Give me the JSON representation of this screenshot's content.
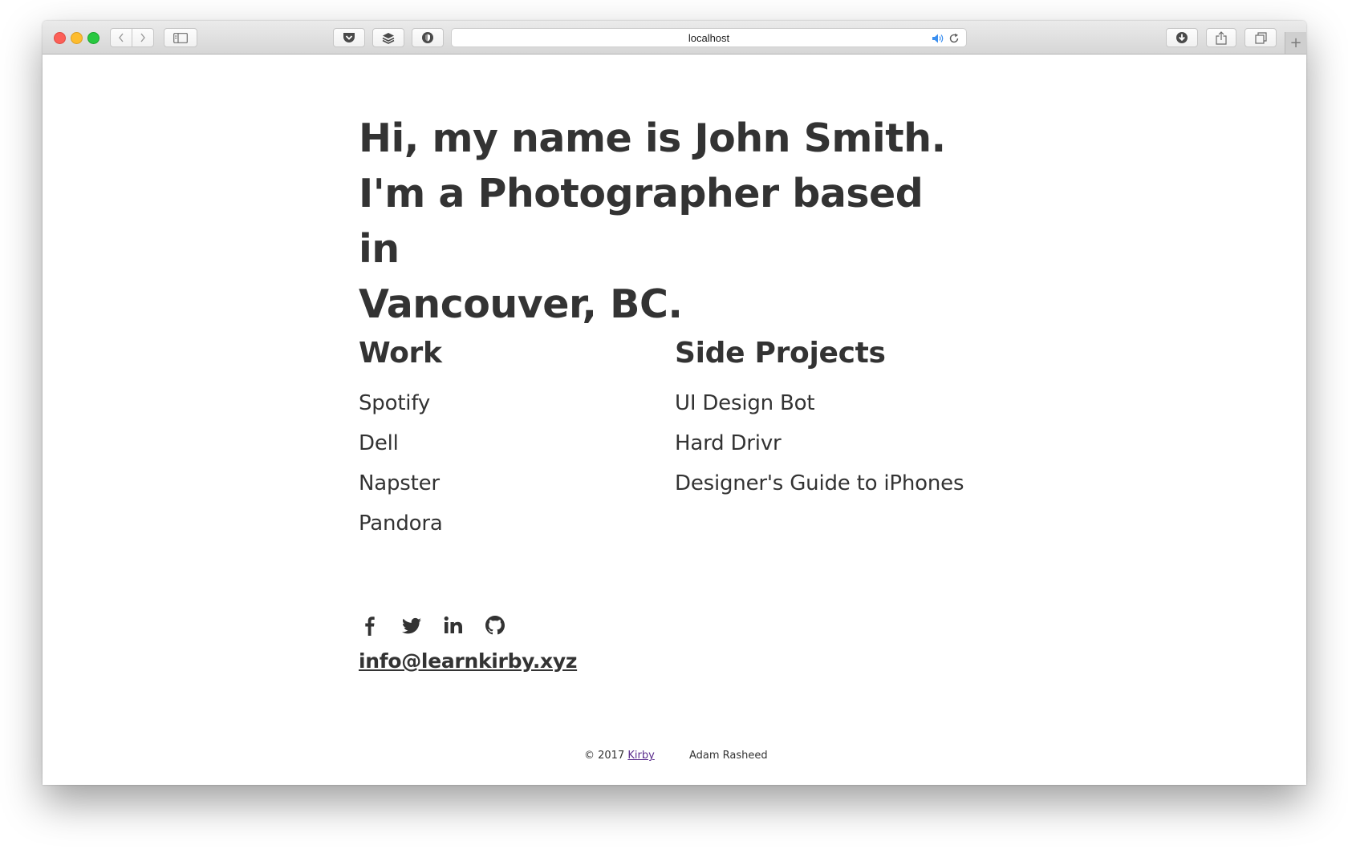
{
  "browser": {
    "url": "localhost"
  },
  "hero": {
    "line1": "Hi, my name is John Smith.",
    "line2": "I'm a Photographer based in",
    "line3": "Vancouver, BC."
  },
  "work": {
    "heading": "Work",
    "items": [
      "Spotify",
      "Dell",
      "Napster",
      "Pandora"
    ]
  },
  "side_projects": {
    "heading": "Side Projects",
    "items": [
      "UI Design Bot",
      "Hard Drivr",
      "Designer's Guide to iPhones"
    ]
  },
  "social": {
    "icons": [
      "facebook-icon",
      "twitter-icon",
      "linkedin-icon",
      "github-icon"
    ]
  },
  "contact": {
    "email": "info@learnkirby.xyz"
  },
  "footer": {
    "copyright_prefix": "© 2017",
    "copyright_link": "Kirby",
    "author": "Adam Rasheed"
  },
  "colors": {
    "text": "#333333",
    "link_visited": "#5a2c8c",
    "traffic_red": "#fc5f57",
    "traffic_yellow": "#fdbc2e",
    "traffic_green": "#28c840"
  }
}
